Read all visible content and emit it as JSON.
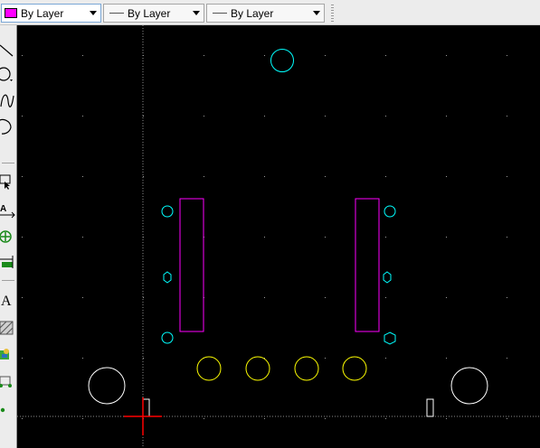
{
  "toolbar": {
    "color_combo": {
      "value": "By Layer",
      "swatch_color": "#ff00ff"
    },
    "linetype_combo": {
      "value": "By Layer"
    },
    "lineweight_combo": {
      "value": "By Layer"
    }
  },
  "left_toolbar": {
    "tools": [
      {
        "name": "line-tool-icon"
      },
      {
        "name": "circle-tool-icon"
      },
      {
        "name": "spline-tool-icon"
      },
      {
        "name": "arc-tool-icon"
      },
      {
        "name": "selection-tool-icon"
      },
      {
        "name": "text-dimension-tool-icon"
      },
      {
        "name": "center-mark-tool-icon"
      },
      {
        "name": "linear-dimension-tool-icon"
      },
      {
        "name": "multiline-text-tool-icon",
        "glyph": "A"
      },
      {
        "name": "hatch-tool-icon"
      },
      {
        "name": "insert-block-tool-icon"
      },
      {
        "name": "insert-image-tool-icon"
      },
      {
        "name": "point-tool-icon"
      }
    ]
  },
  "drawing": {
    "background": "#000000",
    "colors": {
      "cyan": "#00ffff",
      "magenta": "#ff00ff",
      "yellow": "#ffff00",
      "white": "#ffffff",
      "crosshair": "#ff0000",
      "grid_dot": "#9a9a9a"
    }
  }
}
